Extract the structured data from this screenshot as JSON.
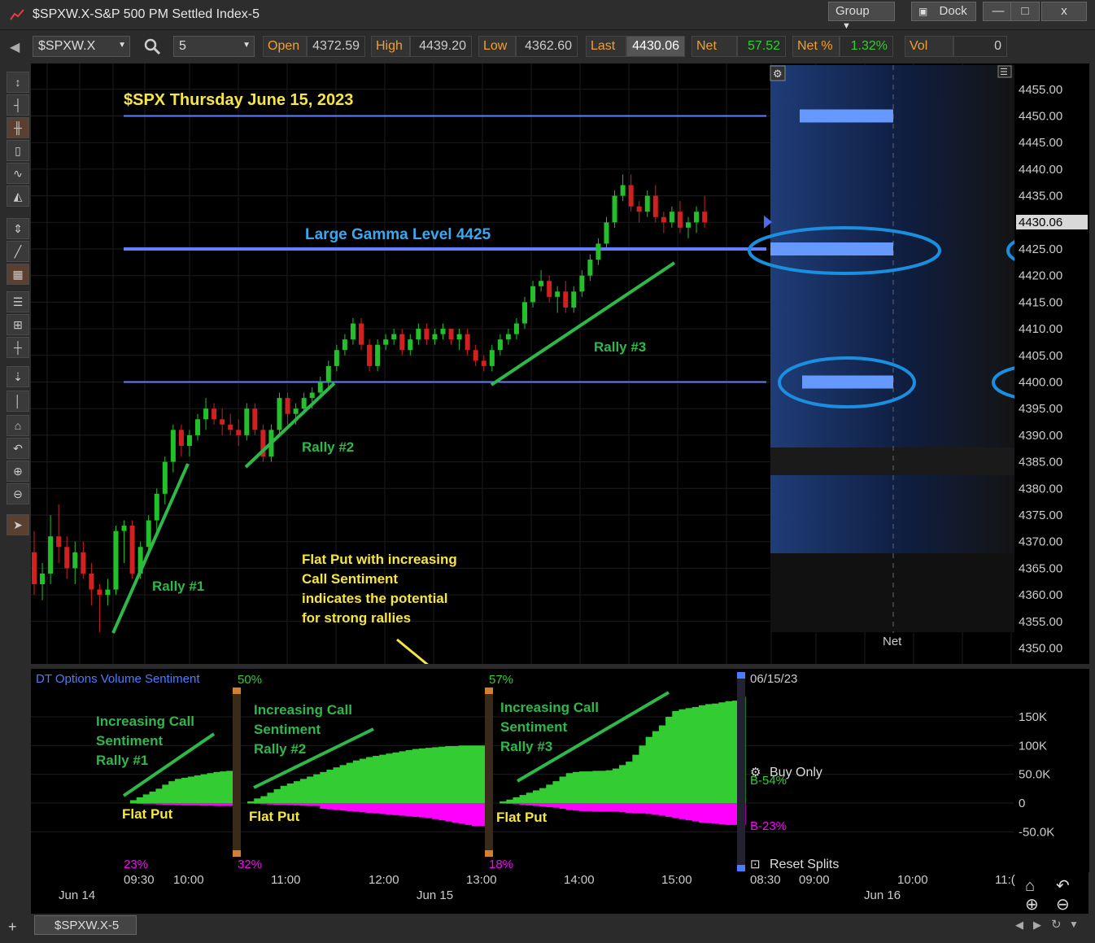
{
  "window": {
    "title": "$SPXW.X-S&P 500 PM Settled Index-5",
    "group_label": "Group",
    "dock_label": "Dock",
    "minimize_label": "—",
    "maximize_label": "□",
    "close_label": "x"
  },
  "toolbar": {
    "symbol": "$SPXW.X",
    "interval": "5",
    "open_label": "Open",
    "open_value": "4372.59",
    "high_label": "High",
    "high_value": "4439.20",
    "low_label": "Low",
    "low_value": "4362.60",
    "last_label": "Last",
    "last_value": "4430.06",
    "net_label": "Net",
    "net_value": "57.52",
    "netpct_label": "Net %",
    "netpct_value": "1.32%",
    "vol_label": "Vol",
    "vol_value": "0"
  },
  "colors": {
    "background": "#000000",
    "up": "#22c02a",
    "down": "#d02020",
    "levels": "#6080ff",
    "annotation_green": "#2fb84a",
    "title_yellow": "#f5e642",
    "gamma_blue": "#3aa8f0",
    "call_fill": "#33cc33",
    "put_fill": "#ff00ff",
    "circle_blue": "#1a8fe0"
  },
  "annotations": {
    "title": "$SPX Thursday June 15, 2023",
    "gamma": "Large Gamma Level 4425",
    "rally1": "Rally #1",
    "rally2": "Rally #2",
    "rally3": "Rally #3",
    "note_line1": "Flat Put with increasing",
    "note_line2": "Call Sentiment",
    "note_line3": "indicates the potential",
    "note_line4": "for strong rallies",
    "inc1_l1": "Increasing Call",
    "inc1_l2": "Sentiment",
    "inc1_l3": "Rally #1",
    "inc2_l1": "Increasing Call",
    "inc2_l2": "Sentiment",
    "inc2_l3": "Rally #2",
    "inc3_l1": "Increasing Call",
    "inc3_l2": "Sentiment",
    "inc3_l3": "Rally #3",
    "flat_put": "Flat Put"
  },
  "price_axis": {
    "ticks": [
      "4455.00",
      "4450.00",
      "4445.00",
      "4440.00",
      "4435.00",
      "4430.06",
      "4425.00",
      "4420.00",
      "4415.00",
      "4410.00",
      "4405.00",
      "4400.00",
      "4395.00",
      "4390.00",
      "4385.00",
      "4380.00",
      "4375.00",
      "4370.00",
      "4365.00",
      "4360.00",
      "4355.00",
      "4350.00"
    ],
    "last_tag": "4430.06"
  },
  "profile": {
    "net_label": "Net"
  },
  "sentiment_panel": {
    "title": "DT Options Volume Sentiment",
    "pct_top_1": "50%",
    "pct_top_2": "57%",
    "pct_bottom_0": "23%",
    "pct_bottom_1": "32%",
    "pct_bottom_2": "18%",
    "date": "06/15/23",
    "buy_only": "Buy Only",
    "b_call": "B-54%",
    "b_put": "B-23%",
    "reset_splits": "Reset Splits",
    "axis": [
      "150K",
      "100K",
      "50.0K",
      "0",
      "-50.0K"
    ]
  },
  "time_axis": {
    "times": [
      "09:30",
      "10:00",
      "11:00",
      "12:00",
      "13:00",
      "14:00",
      "15:00",
      "08:30",
      "09:00",
      "10:00",
      "11:("
    ],
    "days": [
      "Jun 14",
      "Jun 15",
      "Jun 16"
    ]
  },
  "footer": {
    "tab": "$SPXW.X-5"
  },
  "chart_data": {
    "type": "candlestick",
    "title": "$SPX Thursday June 15, 2023",
    "ylim": [
      4348,
      4459
    ],
    "grid": true,
    "horizontal_levels": [
      4450,
      4425,
      4400
    ],
    "highlighted_levels": [
      4425,
      4400
    ],
    "last_price": 4430.06,
    "candles": [
      {
        "o": 4368,
        "h": 4372,
        "l": 4360,
        "c": 4362
      },
      {
        "o": 4362,
        "h": 4366,
        "l": 4359,
        "c": 4364
      },
      {
        "o": 4364,
        "h": 4375,
        "l": 4362,
        "c": 4371
      },
      {
        "o": 4371,
        "h": 4377,
        "l": 4366,
        "c": 4369
      },
      {
        "o": 4369,
        "h": 4371,
        "l": 4363,
        "c": 4365
      },
      {
        "o": 4365,
        "h": 4370,
        "l": 4362,
        "c": 4368
      },
      {
        "o": 4368,
        "h": 4370,
        "l": 4363,
        "c": 4364
      },
      {
        "o": 4364,
        "h": 4366,
        "l": 4358,
        "c": 4361
      },
      {
        "o": 4361,
        "h": 4362,
        "l": 4353,
        "c": 4360
      },
      {
        "o": 4360,
        "h": 4363,
        "l": 4358,
        "c": 4361
      },
      {
        "o": 4361,
        "h": 4373,
        "l": 4360,
        "c": 4372
      },
      {
        "o": 4372,
        "h": 4374,
        "l": 4366,
        "c": 4373
      },
      {
        "o": 4373,
        "h": 4374,
        "l": 4363,
        "c": 4364
      },
      {
        "o": 4364,
        "h": 4370,
        "l": 4363,
        "c": 4369
      },
      {
        "o": 4369,
        "h": 4375,
        "l": 4368,
        "c": 4374
      },
      {
        "o": 4374,
        "h": 4380,
        "l": 4372,
        "c": 4379
      },
      {
        "o": 4379,
        "h": 4386,
        "l": 4377,
        "c": 4385
      },
      {
        "o": 4385,
        "h": 4392,
        "l": 4383,
        "c": 4391
      },
      {
        "o": 4391,
        "h": 4392,
        "l": 4386,
        "c": 4388
      },
      {
        "o": 4388,
        "h": 4391,
        "l": 4386,
        "c": 4390
      },
      {
        "o": 4390,
        "h": 4394,
        "l": 4389,
        "c": 4393
      },
      {
        "o": 4393,
        "h": 4397,
        "l": 4391,
        "c": 4395
      },
      {
        "o": 4395,
        "h": 4396,
        "l": 4392,
        "c": 4393
      },
      {
        "o": 4393,
        "h": 4395,
        "l": 4390,
        "c": 4392
      },
      {
        "o": 4392,
        "h": 4394,
        "l": 4390,
        "c": 4391
      },
      {
        "o": 4391,
        "h": 4393,
        "l": 4388,
        "c": 4390
      },
      {
        "o": 4390,
        "h": 4396,
        "l": 4389,
        "c": 4395
      },
      {
        "o": 4395,
        "h": 4396,
        "l": 4390,
        "c": 4391
      },
      {
        "o": 4391,
        "h": 4392,
        "l": 4385,
        "c": 4386
      },
      {
        "o": 4386,
        "h": 4392,
        "l": 4385,
        "c": 4391
      },
      {
        "o": 4391,
        "h": 4398,
        "l": 4390,
        "c": 4397
      },
      {
        "o": 4397,
        "h": 4398,
        "l": 4392,
        "c": 4394
      },
      {
        "o": 4394,
        "h": 4396,
        "l": 4392,
        "c": 4395
      },
      {
        "o": 4395,
        "h": 4398,
        "l": 4394,
        "c": 4397
      },
      {
        "o": 4397,
        "h": 4399,
        "l": 4395,
        "c": 4398
      },
      {
        "o": 4398,
        "h": 4401,
        "l": 4397,
        "c": 4400
      },
      {
        "o": 4400,
        "h": 4404,
        "l": 4399,
        "c": 4403
      },
      {
        "o": 4403,
        "h": 4407,
        "l": 4402,
        "c": 4406
      },
      {
        "o": 4406,
        "h": 4409,
        "l": 4405,
        "c": 4408
      },
      {
        "o": 4408,
        "h": 4412,
        "l": 4407,
        "c": 4411
      },
      {
        "o": 4411,
        "h": 4412,
        "l": 4406,
        "c": 4407
      },
      {
        "o": 4407,
        "h": 4408,
        "l": 4402,
        "c": 4403
      },
      {
        "o": 4403,
        "h": 4408,
        "l": 4402,
        "c": 4407
      },
      {
        "o": 4407,
        "h": 4409,
        "l": 4406,
        "c": 4408
      },
      {
        "o": 4408,
        "h": 4410,
        "l": 4407,
        "c": 4409
      },
      {
        "o": 4409,
        "h": 4410,
        "l": 4405,
        "c": 4406
      },
      {
        "o": 4406,
        "h": 4409,
        "l": 4405,
        "c": 4408
      },
      {
        "o": 4408,
        "h": 4411,
        "l": 4407,
        "c": 4410
      },
      {
        "o": 4410,
        "h": 4411,
        "l": 4407,
        "c": 4408
      },
      {
        "o": 4408,
        "h": 4410,
        "l": 4407,
        "c": 4409
      },
      {
        "o": 4409,
        "h": 4411,
        "l": 4408,
        "c": 4410
      },
      {
        "o": 4410,
        "h": 4410,
        "l": 4407,
        "c": 4408
      },
      {
        "o": 4408,
        "h": 4410,
        "l": 4406,
        "c": 4409
      },
      {
        "o": 4409,
        "h": 4410,
        "l": 4405,
        "c": 4406
      },
      {
        "o": 4406,
        "h": 4407,
        "l": 4403,
        "c": 4404
      },
      {
        "o": 4404,
        "h": 4405,
        "l": 4402,
        "c": 4403
      },
      {
        "o": 4403,
        "h": 4407,
        "l": 4402,
        "c": 4406
      },
      {
        "o": 4406,
        "h": 4409,
        "l": 4405,
        "c": 4408
      },
      {
        "o": 4408,
        "h": 4410,
        "l": 4407,
        "c": 4409
      },
      {
        "o": 4409,
        "h": 4412,
        "l": 4408,
        "c": 4411
      },
      {
        "o": 4411,
        "h": 4416,
        "l": 4410,
        "c": 4415
      },
      {
        "o": 4415,
        "h": 4419,
        "l": 4414,
        "c": 4418
      },
      {
        "o": 4418,
        "h": 4421,
        "l": 4417,
        "c": 4419
      },
      {
        "o": 4419,
        "h": 4420,
        "l": 4415,
        "c": 4416
      },
      {
        "o": 4416,
        "h": 4418,
        "l": 4413,
        "c": 4417
      },
      {
        "o": 4417,
        "h": 4419,
        "l": 4413,
        "c": 4414
      },
      {
        "o": 4414,
        "h": 4418,
        "l": 4413,
        "c": 4417
      },
      {
        "o": 4417,
        "h": 4421,
        "l": 4416,
        "c": 4420
      },
      {
        "o": 4420,
        "h": 4424,
        "l": 4419,
        "c": 4423
      },
      {
        "o": 4423,
        "h": 4427,
        "l": 4422,
        "c": 4426
      },
      {
        "o": 4426,
        "h": 4431,
        "l": 4425,
        "c": 4430
      },
      {
        "o": 4430,
        "h": 4436,
        "l": 4429,
        "c": 4435
      },
      {
        "o": 4435,
        "h": 4439,
        "l": 4434,
        "c": 4437
      },
      {
        "o": 4437,
        "h": 4439,
        "l": 4432,
        "c": 4433
      },
      {
        "o": 4433,
        "h": 4434,
        "l": 4430,
        "c": 4432
      },
      {
        "o": 4432,
        "h": 4436,
        "l": 4431,
        "c": 4435
      },
      {
        "o": 4435,
        "h": 4437,
        "l": 4430,
        "c": 4431
      },
      {
        "o": 4431,
        "h": 4432,
        "l": 4428,
        "c": 4430
      },
      {
        "o": 4430,
        "h": 4433,
        "l": 4429,
        "c": 4432
      },
      {
        "o": 4432,
        "h": 4434,
        "l": 4428,
        "c": 4429
      },
      {
        "o": 4429,
        "h": 4431,
        "l": 4427,
        "c": 4430
      },
      {
        "o": 4430,
        "h": 4433,
        "l": 4428,
        "c": 4432
      },
      {
        "o": 4432,
        "h": 4435,
        "l": 4429,
        "c": 4430
      }
    ],
    "sentiment": {
      "y_axis": [
        "150K",
        "100K",
        "50.0K",
        "0",
        "-50.0K"
      ],
      "ylim": [
        -70000,
        190000
      ],
      "segments": [
        {
          "label": "Rally #1",
          "call": [
            0,
            5000,
            10000,
            15000,
            20000,
            25000,
            32000,
            38000,
            42000,
            44000,
            46000,
            48000,
            50000,
            52000,
            54000,
            55000,
            56000
          ],
          "put": [
            0,
            -1000,
            -1500,
            -2000,
            -2000,
            -2500,
            -3000,
            -3000,
            -3500,
            -4000,
            -4000,
            -4000,
            -4500,
            -4500,
            -5000,
            -5000,
            -5000
          ]
        },
        {
          "label": "Rally #2",
          "call": [
            0,
            3000,
            8000,
            12000,
            18000,
            24000,
            30000,
            34000,
            38000,
            42000,
            46000,
            50000,
            54000,
            58000,
            62000,
            66000,
            70000,
            74000,
            77000,
            80000,
            82000,
            84000,
            86000,
            88000,
            90000,
            92000,
            94000,
            95000,
            96000,
            97000,
            98000,
            99000,
            99000,
            100000,
            100000,
            100000,
            100000
          ],
          "put": [
            0,
            -1000,
            -1500,
            -2000,
            -2500,
            -3000,
            -3000,
            -3500,
            -4000,
            -4500,
            -5000,
            -5000,
            -10000,
            -11000,
            -12000,
            -13000,
            -14000,
            -15000,
            -16000,
            -17000,
            -18000,
            -19000,
            -20000,
            -21000,
            -22000,
            -23000,
            -24000,
            -25000,
            -26000,
            -28000,
            -30000,
            -32000,
            -34000,
            -36000,
            -38000,
            -40000,
            -40000
          ]
        },
        {
          "label": "Rally #3",
          "call": [
            0,
            3000,
            6000,
            10000,
            14000,
            18000,
            22000,
            26000,
            32000,
            38000,
            46000,
            52000,
            54000,
            55000,
            55000,
            56000,
            56000,
            57000,
            60000,
            66000,
            72000,
            84000,
            100000,
            115000,
            125000,
            135000,
            150000,
            160000,
            163000,
            165000,
            167000,
            170000,
            172000,
            173000,
            175000,
            177000,
            178000,
            185000
          ],
          "put": [
            0,
            -1000,
            -1500,
            -2000,
            -3000,
            -4000,
            -5000,
            -6000,
            -7000,
            -8000,
            -10000,
            -12000,
            -13000,
            -14000,
            -14000,
            -15000,
            -15000,
            -15000,
            -15000,
            -16000,
            -17000,
            -18000,
            -18000,
            -19000,
            -20000,
            -22000,
            -24000,
            -26000,
            -28000,
            -30000,
            -32000,
            -34000,
            -35000,
            -36000,
            -37000,
            -38000,
            -38000,
            -38000
          ]
        }
      ]
    }
  }
}
